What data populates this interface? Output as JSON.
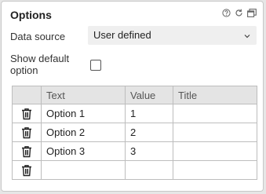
{
  "panel": {
    "title": "Options",
    "icons": [
      "help-icon",
      "refresh-icon",
      "copy-icon"
    ]
  },
  "data_source": {
    "label": "Data source",
    "value": "User defined"
  },
  "show_default_option": {
    "label_line1": "Show default",
    "label_line2": "option",
    "checked": false
  },
  "table": {
    "columns": [
      "",
      "Text",
      "Value",
      "Title"
    ],
    "rows": [
      {
        "text": "Option 1",
        "value": "1",
        "title": ""
      },
      {
        "text": "Option 2",
        "value": "2",
        "title": ""
      },
      {
        "text": "Option 3",
        "value": "3",
        "title": ""
      },
      {
        "text": "",
        "value": "",
        "title": ""
      }
    ]
  }
}
